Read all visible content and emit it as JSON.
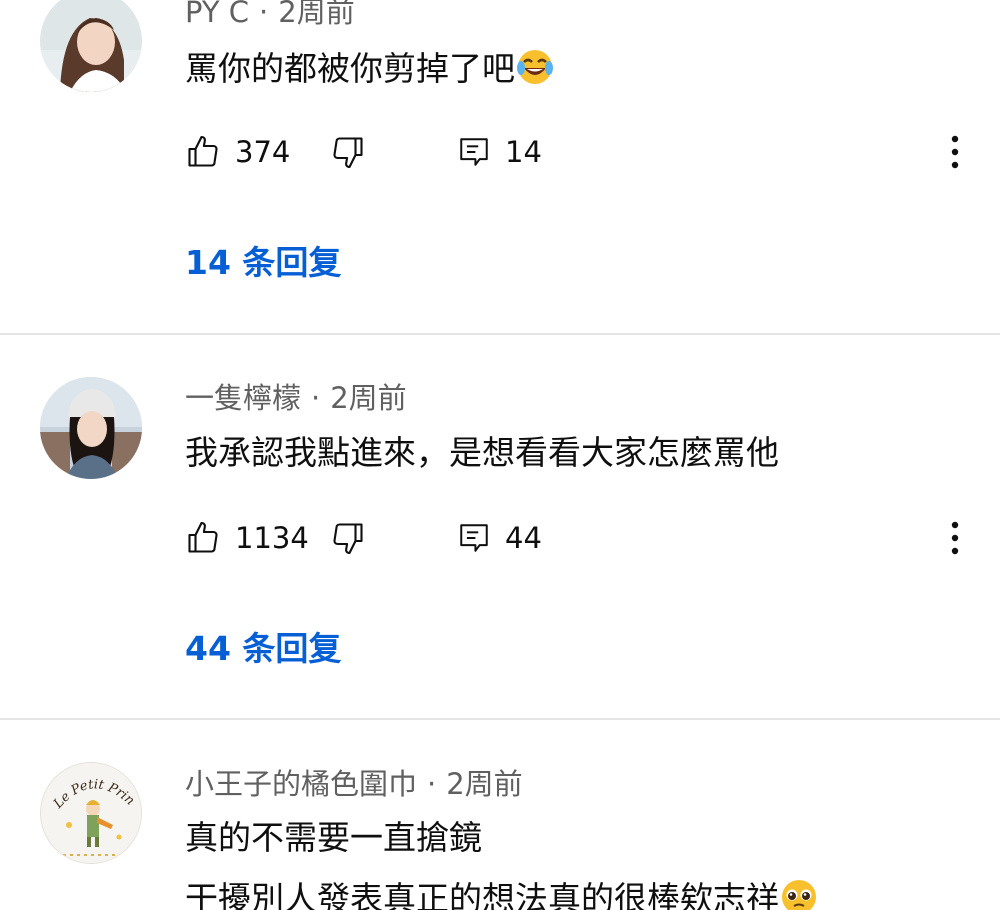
{
  "comments": [
    {
      "author": "PY C",
      "time": "2周前",
      "separator": "·",
      "text": "罵你的都被你剪掉了吧",
      "text_emoji": "face-with-tears-of-joy",
      "likes": "374",
      "reply_count": "14",
      "replies_label": "14 条回复"
    },
    {
      "author": "一隻檸檬",
      "time": "2周前",
      "separator": "·",
      "text": "我承認我點進來，是想看看大家怎麼罵他",
      "likes": "1134",
      "reply_count": "44",
      "replies_label": "44 条回复"
    },
    {
      "author": "小王子的橘色圍巾",
      "time": "2周前",
      "separator": "·",
      "text_line1": "真的不需要一直搶鏡",
      "text_line2": "干擾別人發表真正的想法真的很棒欸志祥",
      "text_emoji": "pleading-face",
      "avatar_logo_text": "Le Petit Prince"
    }
  ],
  "icons": {
    "like": "thumbs-up-icon",
    "dislike": "thumbs-down-icon",
    "reply": "comment-icon",
    "more": "more-vertical-icon"
  },
  "colors": {
    "link": "#065fd4",
    "meta": "#606060",
    "text": "#0f0f0f",
    "divider": "#e5e5e5"
  }
}
